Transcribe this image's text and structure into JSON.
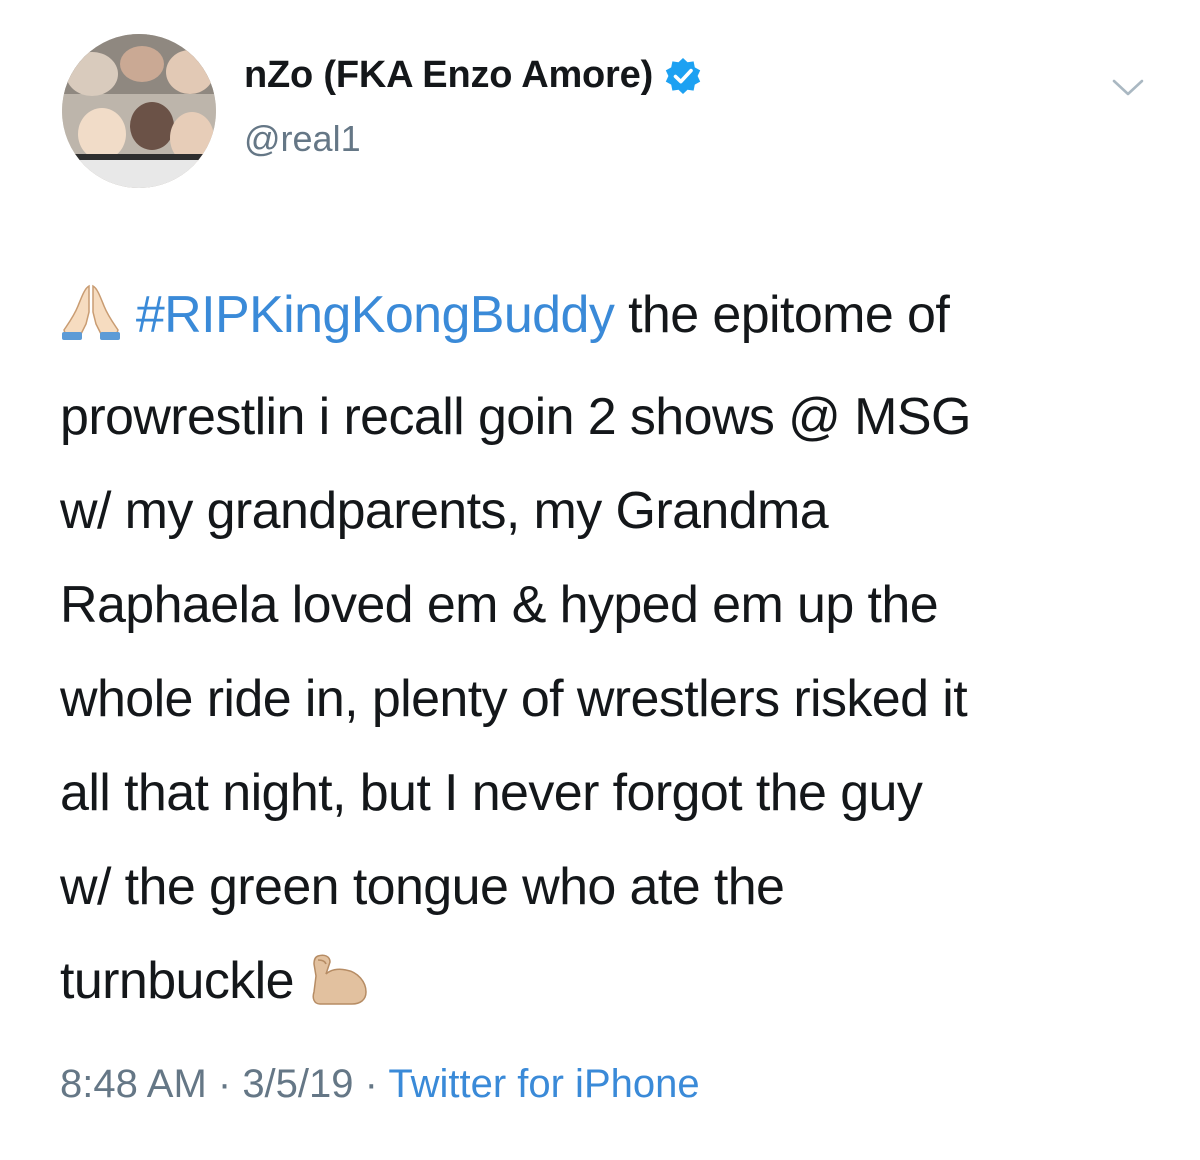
{
  "user": {
    "display_name": "nZo (FKA Enzo Amore)",
    "handle": "@real1",
    "verified": true,
    "avatar_icon": "profile-photo",
    "verified_icon": "verified-badge-icon",
    "menu_icon": "chevron-down-icon"
  },
  "tweet": {
    "emoji_start": "folded-hands",
    "hashtag": "#RIPKingKongBuddy",
    "line1_rest": " the epitome of",
    "line2": "prowrestlin i recall goin 2 shows @ MSG",
    "line3": "w/ my grandparents, my Grandma",
    "line4": "Raphaela loved em & hyped em up the",
    "line5": "whole ride in, plenty of wrestlers risked it",
    "line6": "all that night, but I never forgot the guy",
    "line7": "w/ the green tongue who ate the",
    "line8": "turnbuckle",
    "emoji_end": "flexed-biceps"
  },
  "meta": {
    "time": "8:48 AM",
    "sep1": " · ",
    "date": "3/5/19",
    "sep2": " · ",
    "source": "Twitter for iPhone"
  },
  "colors": {
    "link": "#3a8ad8",
    "secondary": "#657786",
    "text": "#14171a",
    "verified": "#1da1f2"
  }
}
